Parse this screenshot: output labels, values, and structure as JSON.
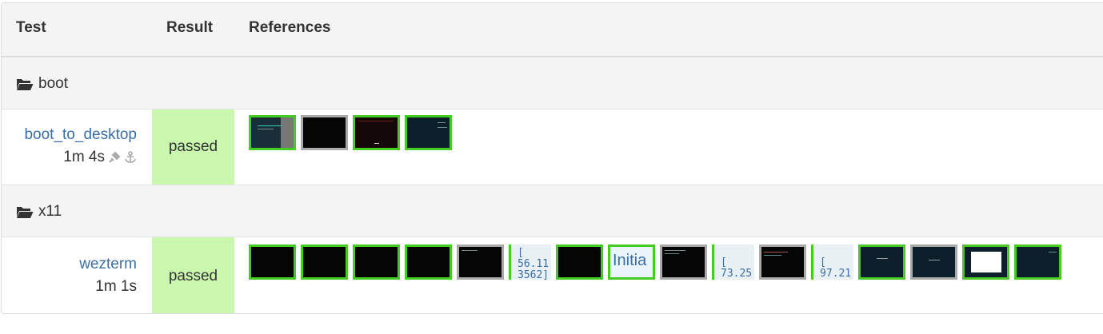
{
  "headers": {
    "test": "Test",
    "result": "Result",
    "references": "References"
  },
  "groups": [
    {
      "name": "boot",
      "icon": "folder-open-icon",
      "tests": [
        {
          "name": "boot_to_desktop",
          "duration": "1m 4s",
          "icons": [
            "plug-icon",
            "anchor-icon"
          ],
          "result": "passed",
          "references": [
            "green",
            "grey",
            "green",
            "green"
          ]
        }
      ]
    },
    {
      "name": "x11",
      "icon": "folder-open-icon",
      "tests": [
        {
          "name": "wezterm",
          "duration": "1m 1s",
          "result": "passed",
          "references": [
            "green",
            "green",
            "green",
            "green",
            "grey",
            "text",
            "green",
            "text",
            "grey",
            "text",
            "grey",
            "text",
            "green",
            "grey",
            "green",
            "green"
          ],
          "text_refs": [
            {
              "line1": "[",
              "line2": "56.11",
              "line3": "3562]"
            },
            {
              "line1": "Initia"
            },
            {
              "line1": "[",
              "line2": "73.25"
            },
            {
              "line1": "[",
              "line2": "97.21"
            }
          ]
        }
      ]
    }
  ],
  "colors": {
    "passed_bg": "#c9f7ad",
    "link": "#3b6ea5",
    "ok_border": "#44cc22",
    "neutral_border": "#a9a9a9"
  }
}
